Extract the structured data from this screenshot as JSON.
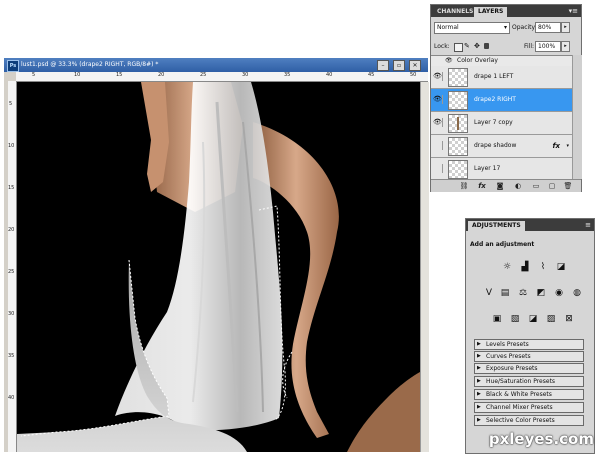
{
  "document": {
    "title": "lust1.psd @ 33.3% (drape2 RIGHT, RGB/8#) *",
    "app_badge": "Ps",
    "window_buttons": [
      "–",
      "▫",
      "✕"
    ],
    "ruler_top_ticks": [
      "5",
      "10",
      "15",
      "20",
      "25",
      "30",
      "35",
      "40",
      "45",
      "50"
    ],
    "ruler_left_ticks": [
      "5",
      "10",
      "15",
      "20",
      "25",
      "30",
      "35",
      "40"
    ]
  },
  "layers_panel": {
    "tabs": [
      {
        "label": "CHANNELS",
        "active": false
      },
      {
        "label": "LAYERS",
        "active": true
      }
    ],
    "blend_mode": "Normal",
    "opacity_label": "Opacity:",
    "opacity_value": "80%",
    "lock_label": "Lock:",
    "fill_label": "Fill:",
    "fill_value": "100%",
    "effect_row": "Color Overlay",
    "layers": [
      {
        "name": "drape 1 LEFT",
        "visible": true,
        "selected": false,
        "fx": false
      },
      {
        "name": "drape2 RIGHT",
        "visible": true,
        "selected": true,
        "fx": false
      },
      {
        "name": "Layer 7 copy",
        "visible": true,
        "selected": false,
        "fx": false
      },
      {
        "name": "drape shadow",
        "visible": false,
        "selected": false,
        "fx": true
      },
      {
        "name": "Layer 17",
        "visible": false,
        "selected": false,
        "fx": false
      }
    ],
    "fx_label": "fx",
    "footer_icons": [
      "link-icon",
      "fx-icon",
      "mask-icon",
      "adjustment-icon",
      "folder-icon",
      "new-layer-icon",
      "trash-icon"
    ]
  },
  "adjustments_panel": {
    "tab": "ADJUSTMENTS",
    "heading": "Add an adjustment",
    "presets": [
      "Levels Presets",
      "Curves Presets",
      "Exposure Presets",
      "Hue/Saturation Presets",
      "Black & White Presets",
      "Channel Mixer Presets",
      "Selective Color Presets"
    ]
  },
  "watermark": "pxleyes.com",
  "colors": {
    "selected_layer": "#3897f0",
    "canvas_background": "#000000",
    "title_bar": "#2f5fa6"
  }
}
